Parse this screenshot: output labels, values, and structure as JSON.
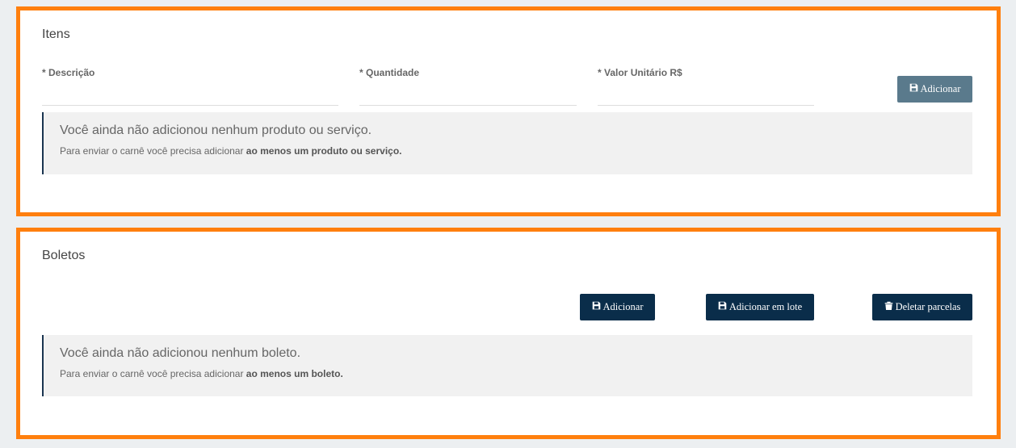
{
  "itens": {
    "title": "Itens",
    "fields": {
      "descricao_label": "* Descrição",
      "quantidade_label": "* Quantidade",
      "valor_label": "* Valor Unitário R$"
    },
    "add_button": "Adicionar",
    "empty_notice": {
      "title": "Você ainda não adicionou nenhum produto ou serviço.",
      "text_prefix": "Para enviar o carnê você precisa adicionar ",
      "text_bold": "ao menos um produto ou serviço."
    }
  },
  "boletos": {
    "title": "Boletos",
    "buttons": {
      "adicionar": "Adicionar",
      "adicionar_lote": "Adicionar em lote",
      "deletar": "Deletar parcelas"
    },
    "empty_notice": {
      "title": "Você ainda não adicionou nenhum boleto.",
      "text_prefix": "Para enviar o carnê você precisa adicionar ",
      "text_bold": "ao menos um boleto."
    }
  },
  "colors": {
    "highlight_border": "#ff7f0e",
    "button_gray": "#5a7a8c",
    "button_navy": "#0a2d4a"
  },
  "icons": {
    "save": "save-icon",
    "trash": "trash-icon"
  }
}
